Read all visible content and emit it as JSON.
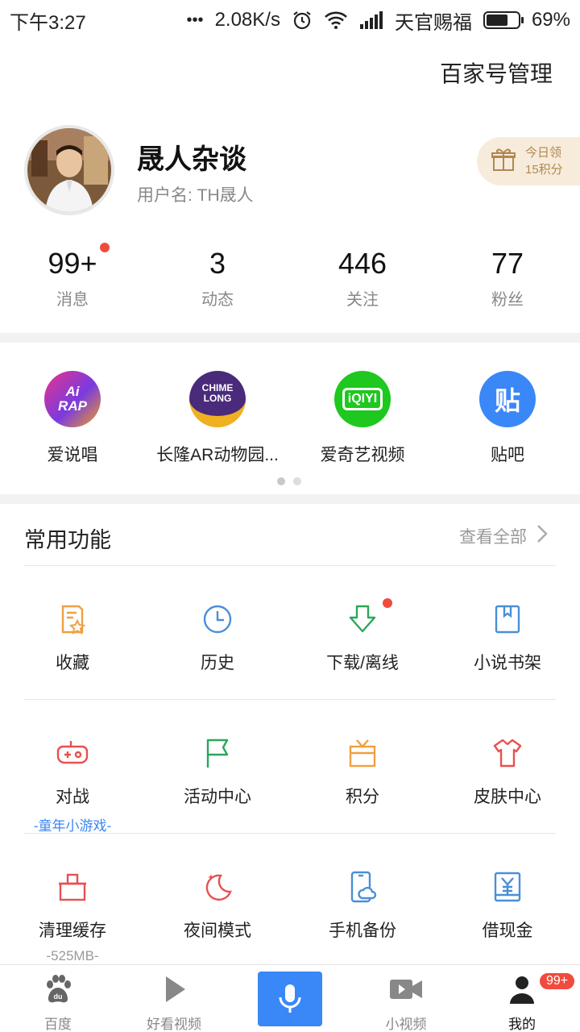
{
  "status_bar": {
    "time": "下午3:27",
    "dots": "•••",
    "speed": "2.08K/s",
    "carrier": "天官赐福",
    "battery": "69%",
    "battery_level": 0.69
  },
  "header": {
    "manage_link": "百家号管理"
  },
  "profile": {
    "name": "晟人杂谈",
    "username": "用户名: TH晟人",
    "points_line1": "今日领",
    "points_line2": "15积分"
  },
  "stats": [
    {
      "value": "99+",
      "label": "消息"
    },
    {
      "value": "3",
      "label": "动态"
    },
    {
      "value": "446",
      "label": "关注"
    },
    {
      "value": "77",
      "label": "粉丝"
    }
  ],
  "apps": [
    {
      "label": "爱说唱",
      "icon_text": "Ai RAP",
      "color": "#8a3cc8"
    },
    {
      "label": "长隆AR动物园...",
      "icon_text": "CHIME LONG",
      "color": "#4a2a7a"
    },
    {
      "label": "爱奇艺视频",
      "icon_text": "iQIYI",
      "color": "#1ec81e"
    },
    {
      "label": "贴吧",
      "icon_text": "贴",
      "color": "#3a87f7"
    }
  ],
  "common": {
    "title": "常用功能",
    "view_all": "查看全部"
  },
  "functions_row1": [
    {
      "label": "收藏",
      "icon": "favorites-icon",
      "color": "#f0a040"
    },
    {
      "label": "历史",
      "icon": "clock-icon",
      "color": "#4a8fd8"
    },
    {
      "label": "下载/离线",
      "icon": "download-icon",
      "color": "#2aa85a"
    },
    {
      "label": "小说书架",
      "icon": "bookshelf-icon",
      "color": "#4a8fd8"
    }
  ],
  "functions_row2": [
    {
      "label": "对战",
      "sub": "-童年小游戏-",
      "icon": "gamepad-icon",
      "color": "#e85050"
    },
    {
      "label": "活动中心",
      "icon": "flag-icon",
      "color": "#2aa85a"
    },
    {
      "label": "积分",
      "icon": "gift-box-icon",
      "color": "#f0a040"
    },
    {
      "label": "皮肤中心",
      "icon": "shirt-icon",
      "color": "#e85050"
    }
  ],
  "functions_row3": [
    {
      "label": "清理缓存",
      "sub": "-525MB-",
      "icon": "broom-icon",
      "color": "#e85050"
    },
    {
      "label": "夜间模式",
      "icon": "moon-icon",
      "color": "#e85050"
    },
    {
      "label": "手机备份",
      "icon": "phone-cloud-icon",
      "color": "#4a8fd8"
    },
    {
      "label": "借现金",
      "icon": "yuan-icon",
      "color": "#4a8fd8"
    }
  ],
  "bottom_nav": [
    {
      "label": "百度",
      "icon": "baidu-paw-icon"
    },
    {
      "label": "好看视频",
      "icon": "play-icon"
    },
    {
      "label": "",
      "icon": "microphone-icon"
    },
    {
      "label": "小视频",
      "icon": "video-camera-icon"
    },
    {
      "label": "我的",
      "icon": "person-icon",
      "badge": "99+"
    }
  ],
  "colors": {
    "accent_blue": "#3a87f7",
    "badge_red": "#f04b3e",
    "sub_blue": "#3a87f7",
    "sub_gray": "#999999"
  }
}
